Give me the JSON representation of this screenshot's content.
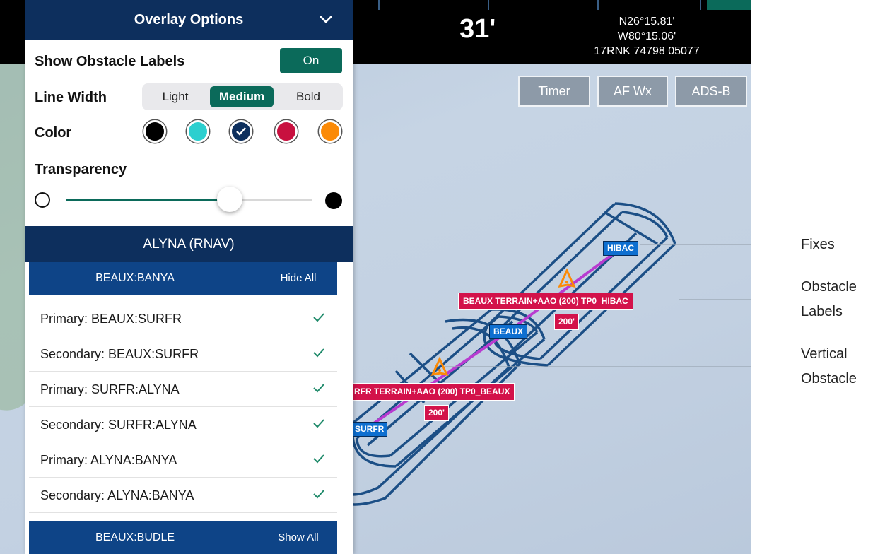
{
  "status_bar": {
    "distance": "31'",
    "lat": "N26°15.81'",
    "lon": "W80°15.06'",
    "grid": "17RNK 74798 05077"
  },
  "map_buttons": {
    "timer": "Timer",
    "wx": "AF Wx",
    "adsb": "ADS-B"
  },
  "overlay": {
    "title": "Overlay Options",
    "obstacle_labels_label": "Show Obstacle Labels",
    "obstacle_labels_value": "On",
    "line_width_label": "Line Width",
    "line_width_options": [
      "Light",
      "Medium",
      "Bold"
    ],
    "line_width_selected": "Medium",
    "color_label": "Color",
    "colors": [
      "#000000",
      "#2ccfcf",
      "#0d2f5d",
      "#c8103f",
      "#fb8a07"
    ],
    "color_selected": "#0d2f5d",
    "transparency_label": "Transparency",
    "transparency": 0.62
  },
  "procedure": {
    "title": "ALYNA (RNAV)",
    "groups": [
      {
        "name": "BEAUX:BANYA",
        "action": "Hide All",
        "items": [
          {
            "label": "Primary: BEAUX:SURFR",
            "checked": true
          },
          {
            "label": "Secondary: BEAUX:SURFR",
            "checked": true
          },
          {
            "label": "Primary: SURFR:ALYNA",
            "checked": true
          },
          {
            "label": "Secondary: SURFR:ALYNA",
            "checked": true
          },
          {
            "label": "Primary: ALYNA:BANYA",
            "checked": true
          },
          {
            "label": "Secondary: ALYNA:BANYA",
            "checked": true
          }
        ]
      },
      {
        "name": "BEAUX:BUDLE",
        "action": "Show All",
        "items": []
      }
    ]
  },
  "map_labels": {
    "fix_hibac": "HIBAC",
    "fix_beaux": "BEAUX",
    "fix_surfr": "SURFR",
    "obstacle_label_1": "BEAUX TERRAIN+AAO (200) TP0_HIBAC",
    "obstacle_height_1": "200'",
    "obstacle_label_2": "RFR TERRAIN+AAO (200) TP0_BEAUX",
    "obstacle_height_2": "200'"
  },
  "callouts": {
    "fixes": "Fixes",
    "obstacle_labels_1": "Obstacle",
    "obstacle_labels_2": "Labels",
    "vertical_obstacle_1": "Vertical",
    "vertical_obstacle_2": "Obstacle"
  },
  "colors": {
    "navy": "#0d2f5d",
    "teal": "#0b6a5a",
    "label_red": "#d3124a",
    "fix_blue": "#0e6fd0",
    "route": "#b83bd0"
  }
}
